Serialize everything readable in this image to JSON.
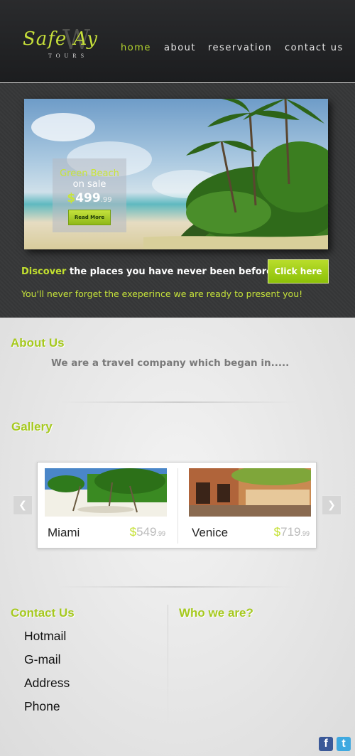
{
  "logo": {
    "script": "Safe  Ay",
    "tours": "TOURS"
  },
  "nav": [
    {
      "label": "home",
      "active": true
    },
    {
      "label": "about",
      "active": false
    },
    {
      "label": "reservation",
      "active": false
    },
    {
      "label": "contact us",
      "active": false
    }
  ],
  "hero": {
    "offer_title": "Green Beach",
    "offer_sub": "on sale",
    "offer_currency": "$",
    "offer_price": "499",
    "offer_cents": ".99",
    "read_more": "Read More",
    "tagline_highlight": "Discover",
    "tagline_rest": " the places you have never been before",
    "cta": "Click here",
    "subline": "You'll never forget the exeperince we are ready to present you!"
  },
  "about": {
    "heading": "About Us",
    "text": "We are a travel company which began in....."
  },
  "gallery": {
    "heading": "Gallery",
    "prev_icon": "chevron-left-icon",
    "next_icon": "chevron-right-icon",
    "items": [
      {
        "name": "Miami",
        "currency": "$",
        "price": "549",
        "cents": ".99"
      },
      {
        "name": "Venice",
        "currency": "$",
        "price": "719",
        "cents": ".99"
      }
    ]
  },
  "contact": {
    "heading": "Contact Us",
    "items": [
      "Hotmail",
      "G-mail",
      "Address",
      "Phone"
    ]
  },
  "who": {
    "heading": "Who we are?"
  },
  "social": {
    "facebook": "f",
    "twitter": "t"
  },
  "colors": {
    "accent": "#b6d72e",
    "header_bg": "#232426",
    "body_bg": "#e9e9e9"
  }
}
